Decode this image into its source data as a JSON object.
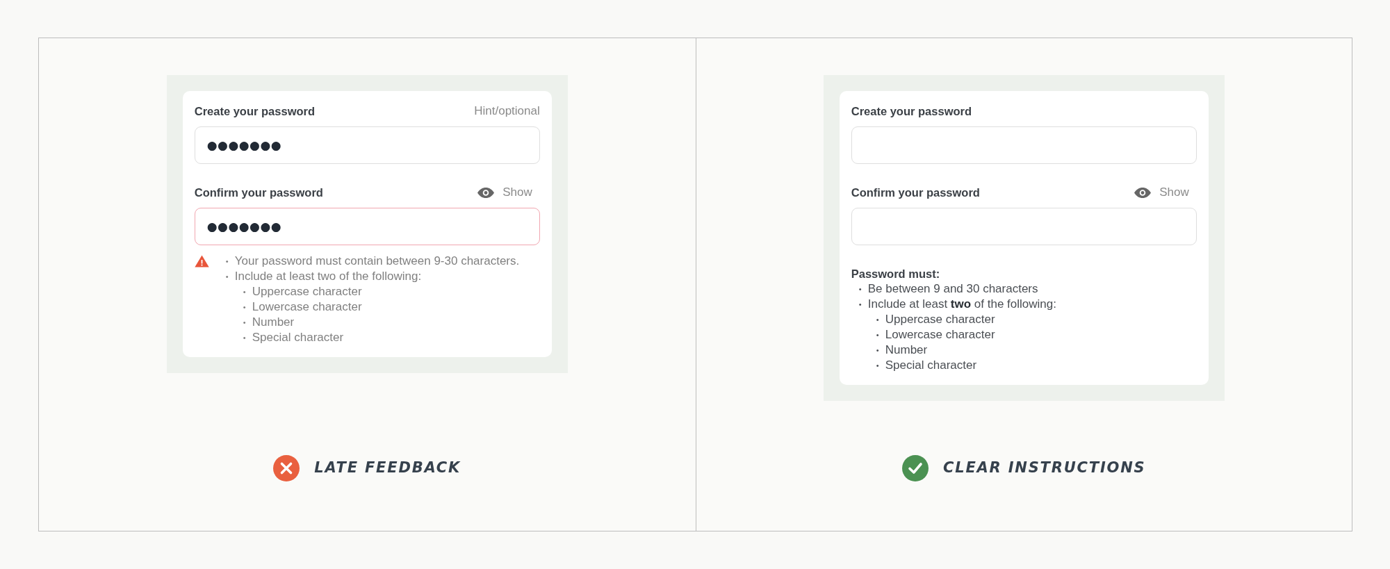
{
  "panels": [
    {
      "form": {
        "fields": [
          {
            "label": "Create your password",
            "aside": {
              "kind": "hint",
              "text": "Hint/optional"
            },
            "value": "●●●●●●●",
            "invalid": false
          },
          {
            "label": "Confirm your password",
            "aside": {
              "kind": "toggle",
              "text": "Show"
            },
            "value": "●●●●●●●",
            "invalid": true
          }
        ],
        "feedback": {
          "kind": "error",
          "items": [
            {
              "bullet": "•",
              "text": "Your password must contain between 9-30 characters."
            },
            {
              "bullet": "•",
              "text": "Include at least two of the following:",
              "children": [
                {
                  "bullet": "•",
                  "text": "Uppercase character"
                },
                {
                  "bullet": "•",
                  "text": "Lowercase character"
                },
                {
                  "bullet": "•",
                  "text": "Number"
                },
                {
                  "bullet": "•",
                  "text": "Special character"
                }
              ]
            }
          ]
        }
      },
      "caption": {
        "kind": "bad",
        "text": "LATE FEEDBACK"
      }
    },
    {
      "form": {
        "fields": [
          {
            "label": "Create your password",
            "invalid": false
          },
          {
            "label": "Confirm your password",
            "aside": {
              "kind": "toggle",
              "text": "Show"
            },
            "invalid": false
          }
        ],
        "feedback": {
          "kind": "instructions",
          "heading": "Password must:",
          "items": [
            {
              "bullet": "•",
              "text": "Be between 9 and 30 characters"
            },
            {
              "bullet": "•",
              "text": "Include at least **two** of the following:",
              "children": [
                {
                  "bullet": "•",
                  "text": "Uppercase character"
                },
                {
                  "bullet": "•",
                  "text": "Lowercase character"
                },
                {
                  "bullet": "•",
                  "text": "Number"
                },
                {
                  "bullet": "•",
                  "text": "Special character"
                }
              ]
            }
          ]
        }
      },
      "caption": {
        "kind": "good",
        "text": "CLEAR INSTRUCTIONS"
      }
    }
  ]
}
